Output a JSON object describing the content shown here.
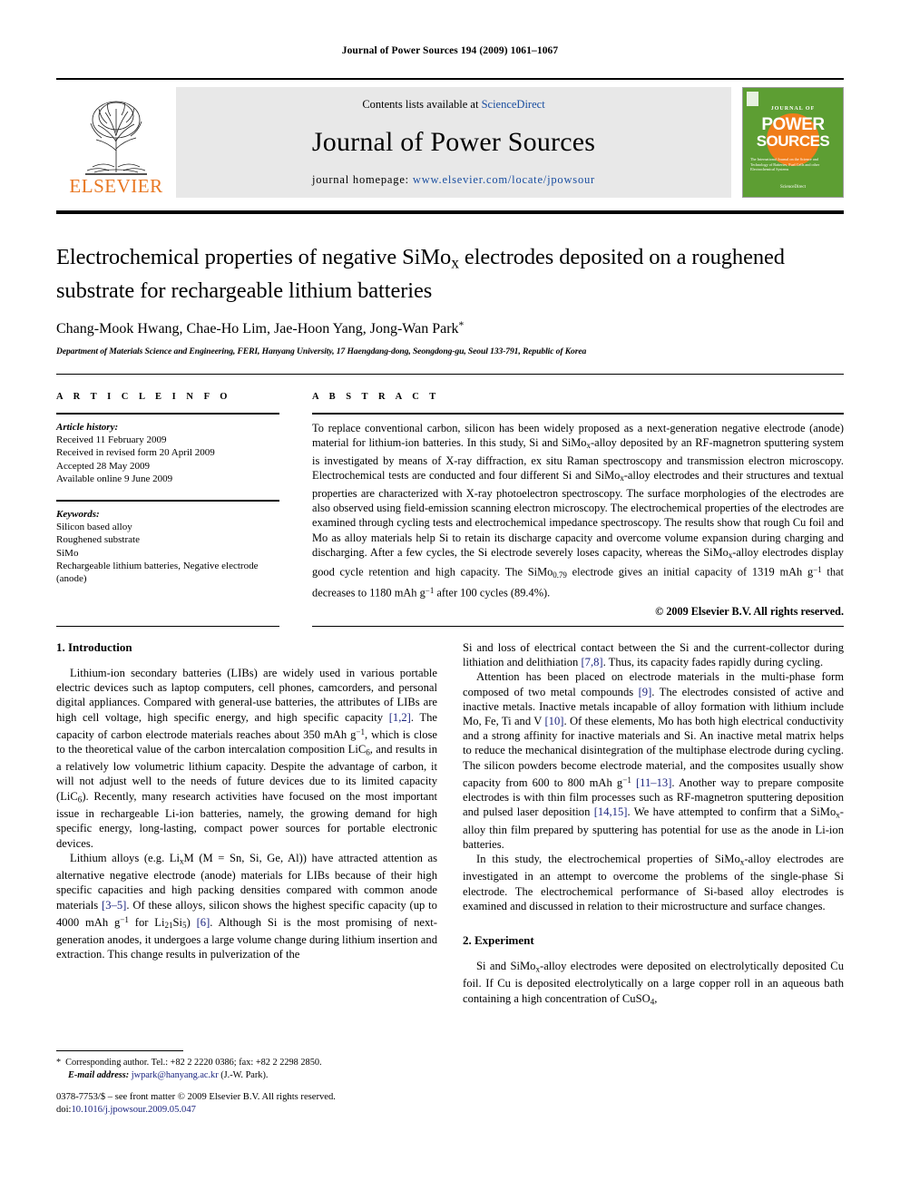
{
  "running_head": "Journal of Power Sources 194 (2009) 1061–1067",
  "masthead": {
    "contents_prefix": "Contents lists available at ",
    "sciencedirect": "ScienceDirect",
    "journal_title": "Journal of Power Sources",
    "homepage_prefix": "journal homepage: ",
    "homepage_url": "www.elsevier.com/locate/jpowsour",
    "publisher": "ELSEVIER",
    "accent_orange": "#e87722",
    "link_blue": "#1a4ea0",
    "cover": {
      "journal_of": "JOURNAL OF",
      "power": "POWER",
      "sources": "SOURCES",
      "subtitle": "The International Journal on the Science and Technology of Batteries, Fuel Cells and other Electrochemical Systems",
      "sciencedirect_mark": "ScienceDirect",
      "bg_color": "#5d9e33",
      "circle_color": "#f07d1a"
    }
  },
  "article": {
    "title": "Electrochemical properties of negative SiMo<sub>x</sub> electrodes deposited on a roughened substrate for rechargeable lithium batteries",
    "authors": "Chang-Mook Hwang, Chae-Ho Lim, Jae-Hoon Yang, Jong-Wan Park",
    "author_star": "*",
    "affiliation": "Department of Materials Science and Engineering, FERI, Hanyang University, 17 Haengdang-dong, Seongdong-gu, Seoul 133-791, Republic of Korea"
  },
  "article_info": {
    "label": "A R T I C L E     I N F O",
    "history_title": "Article history:",
    "history": [
      "Received 11 February 2009",
      "Received in revised form 20 April 2009",
      "Accepted 28 May 2009",
      "Available online 9 June 2009"
    ],
    "keywords_title": "Keywords:",
    "keywords": [
      "Silicon based alloy",
      "Roughened substrate",
      "SiMo",
      "Rechargeable lithium batteries, Negative electrode (anode)"
    ]
  },
  "abstract": {
    "label": "A B S T R A C T",
    "text": "To replace conventional carbon, silicon has been widely proposed as a next-generation negative electrode (anode) material for lithium-ion batteries. In this study, Si and SiMo<sub>x</sub>-alloy deposited by an RF-magnetron sputtering system is investigated by means of X-ray diffraction, ex situ Raman spectroscopy and transmission electron microscopy. Electrochemical tests are conducted and four different Si and SiMo<sub>x</sub>-alloy electrodes and their structures and textual properties are characterized with X-ray photoelectron spectroscopy. The surface morphologies of the electrodes are also observed using field-emission scanning electron microscopy. The electrochemical properties of the electrodes are examined through cycling tests and electrochemical impedance spectroscopy. The results show that rough Cu foil and Mo as alloy materials help Si to retain its discharge capacity and overcome volume expansion during charging and discharging. After a few cycles, the Si electrode severely loses capacity, whereas the SiMo<sub>x</sub>-alloy electrodes display good cycle retention and high capacity. The SiMo<sub>0.79</sub> electrode gives an initial capacity of 1319 mAh g<sup>−1</sup> that decreases to 1180 mAh g<sup>−1</sup> after 100 cycles (89.4%).",
    "copyright": "© 2009 Elsevier B.V. All rights reserved."
  },
  "sections": {
    "introduction_heading": "1.  Introduction",
    "experiment_heading": "2.  Experiment",
    "intro_paragraphs": [
      "Lithium-ion secondary batteries (LIBs) are widely used in various portable electric devices such as laptop computers, cell phones, camcorders, and personal digital appliances. Compared with general-use batteries, the attributes of LIBs are high cell voltage, high specific energy, and high specific capacity <span class=\"cite\">[1,2]</span>. The capacity of carbon electrode materials reaches about 350 mAh g<sup>−1</sup>, which is close to the theoretical value of the carbon intercalation composition LiC<sub>6</sub>, and results in a relatively low volumetric lithium capacity. Despite the advantage of carbon, it will not adjust well to the needs of future devices due to its limited capacity (LiC<sub>6</sub>). Recently, many research activities have focused on the most important issue in rechargeable Li-ion batteries, namely, the growing demand for high specific energy, long-lasting, compact power sources for portable electronic devices.",
      "Lithium alloys (e.g. Li<sub>x</sub>M (M = Sn, Si, Ge, Al)) have attracted attention as alternative negative electrode (anode) materials for LIBs because of their high specific capacities and high packing densities compared with common anode materials <span class=\"cite\">[3–5]</span>. Of these alloys, silicon shows the highest specific capacity (up to 4000 mAh g<sup>−1</sup> for Li<sub>21</sub>Si<sub>5</sub>) <span class=\"cite\">[6]</span>. Although Si is the most promising of next-generation anodes, it undergoes a large volume change during lithium insertion and extraction. This change results in pulverization of the"
    ],
    "right_paragraphs": [
      "Si and loss of electrical contact between the Si and the current-collector during lithiation and delithiation <span class=\"cite\">[7,8]</span>. Thus, its capacity fades rapidly during cycling.",
      "Attention has been placed on electrode materials in the multi-phase form composed of two metal compounds <span class=\"cite\">[9]</span>. The electrodes consisted of active and inactive metals. Inactive metals incapable of alloy formation with lithium include Mo, Fe, Ti and V <span class=\"cite\">[10]</span>. Of these elements, Mo has both high electrical conductivity and a strong affinity for inactive materials and Si. An inactive metal matrix helps to reduce the mechanical disintegration of the multiphase electrode during cycling. The silicon powders become electrode material, and the composites usually show capacity from 600 to 800 mAh g<sup>−1</sup> <span class=\"cite\">[11–13]</span>. Another way to prepare composite electrodes is with thin film processes such as RF-magnetron sputtering deposition and pulsed laser deposition <span class=\"cite\">[14,15]</span>. We have attempted to confirm that a SiMo<sub>x</sub>-alloy thin film prepared by sputtering has potential for use as the anode in Li-ion batteries.",
      "In this study, the electrochemical properties of SiMo<sub>x</sub>-alloy electrodes are investigated in an attempt to overcome the problems of the single-phase Si electrode. The electrochemical performance of Si-based alloy electrodes is examined and discussed in relation to their microstructure and surface changes."
    ],
    "experiment_paragraphs": [
      "Si and SiMo<sub>x</sub>-alloy electrodes were deposited on electrolytically deposited Cu foil. If Cu is deposited electrolytically on a large copper roll in an aqueous bath containing a high concentration of CuSO<sub>4</sub>,"
    ]
  },
  "footnote": {
    "star": "*",
    "corresponding": "Corresponding author. Tel.: +82 2 2220 0386; fax: +82 2 2298 2850.",
    "email_label": "E-mail address:",
    "email": "jwpark@hanyang.ac.kr",
    "email_suffix": "(J.-W. Park)."
  },
  "bottom": {
    "front_matter": "0378-7753/$ – see front matter © 2009 Elsevier B.V. All rights reserved.",
    "doi_label": "doi:",
    "doi": "10.1016/j.jpowsour.2009.05.047"
  }
}
